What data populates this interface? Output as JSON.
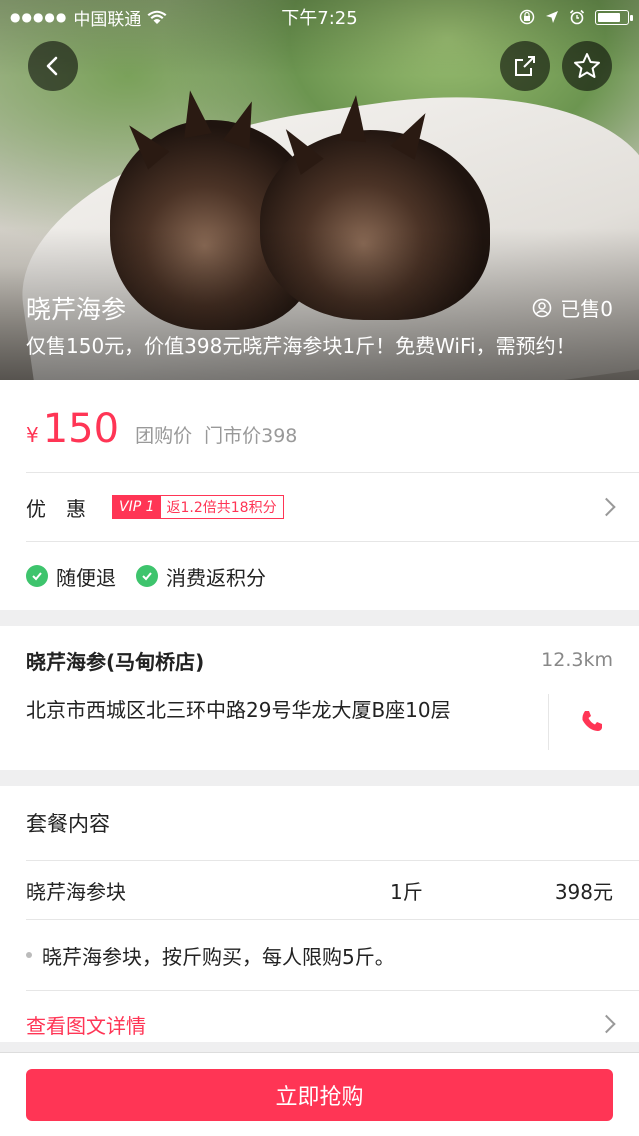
{
  "status_bar": {
    "carrier": "中国联通",
    "time": "下午7:25"
  },
  "hero": {
    "title": "晓芹海参",
    "sold": "已售0",
    "subtitle": "仅售150元，价值398元晓芹海参块1斤！免费WiFi，需预约！"
  },
  "price": {
    "currency": "¥",
    "amount": "150",
    "group_label": "团购价",
    "store_price": "门市价398"
  },
  "discount": {
    "label": "优　惠",
    "vip_tag": "VIP 1",
    "vip_text": "返1.2倍共18积分"
  },
  "features": [
    "随便退",
    "消费返积分"
  ],
  "shop": {
    "name": "晓芹海参(马甸桥店)",
    "distance": "12.3km",
    "address": "北京市西城区北三环中路29号华龙大厦B座10层"
  },
  "package": {
    "title": "套餐内容",
    "items": [
      {
        "name": "晓芹海参块",
        "qty": "1斤",
        "price": "398元"
      }
    ],
    "note": "晓芹海参块，按斤购买，每人限购5斤。",
    "detail_link": "查看图文详情"
  },
  "buy_button": "立即抢购",
  "colors": {
    "accent": "#ff3555",
    "check_green": "#3ec46d"
  }
}
